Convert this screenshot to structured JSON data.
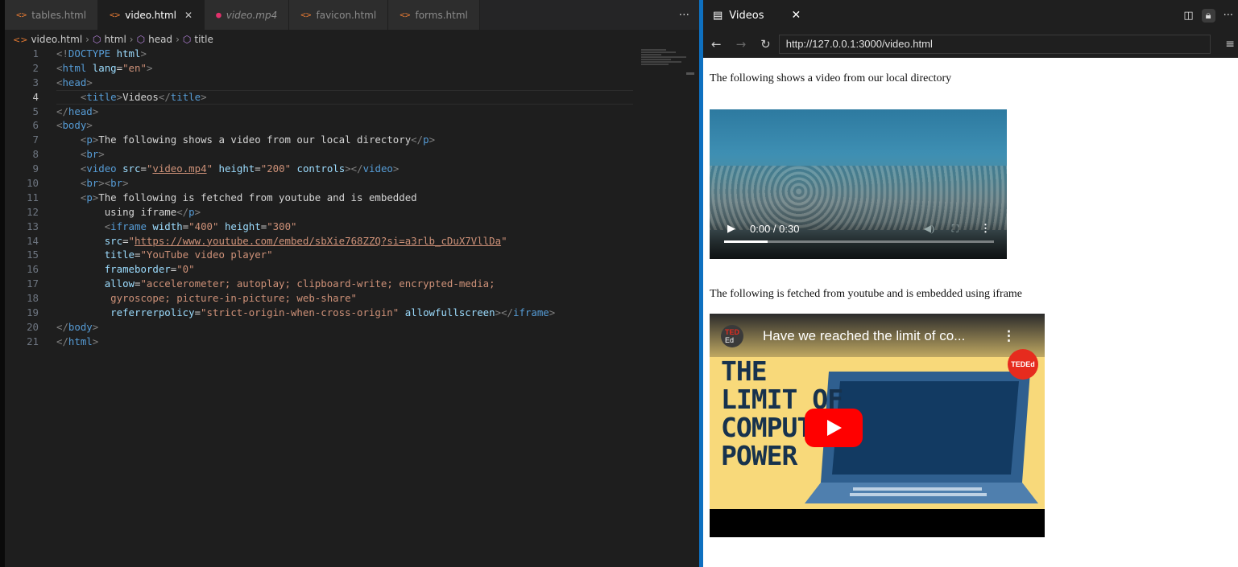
{
  "editor": {
    "tabs": [
      {
        "label": "tables.html",
        "active": false,
        "italic": false
      },
      {
        "label": "video.html",
        "active": true,
        "italic": false
      },
      {
        "label": "video.mp4",
        "active": false,
        "italic": true
      },
      {
        "label": "favicon.html",
        "active": false,
        "italic": false
      },
      {
        "label": "forms.html",
        "active": false,
        "italic": false
      }
    ],
    "more_label": "···",
    "breadcrumb": [
      "video.html",
      "html",
      "head",
      "title"
    ],
    "current_line": 4
  },
  "browser": {
    "tab_title": "Videos",
    "url": "http://127.0.0.1:3000/video.html",
    "page": {
      "paragraph1": "The following shows a video from our local directory",
      "video_time": "0:00 / 0:30",
      "video_progress_fraction": 0.16,
      "paragraph2": "The following is fetched from youtube and is embedded using iframe",
      "youtube_title": "Have we reached the limit of co...",
      "channel_badge": "TEDEd",
      "channel_avatar_top": "TED",
      "channel_avatar_bottom": "Ed",
      "thumbnail_text": [
        "THE",
        "LIMIT OF",
        "COMPUTE",
        "POWER"
      ]
    }
  },
  "colors": {
    "editor_bg": "#1e1e1e",
    "accent": "#0e70c0",
    "youtube_red": "#ff0000",
    "ted_red": "#e62b1e",
    "thumbnail_yellow": "#f8d97a"
  }
}
